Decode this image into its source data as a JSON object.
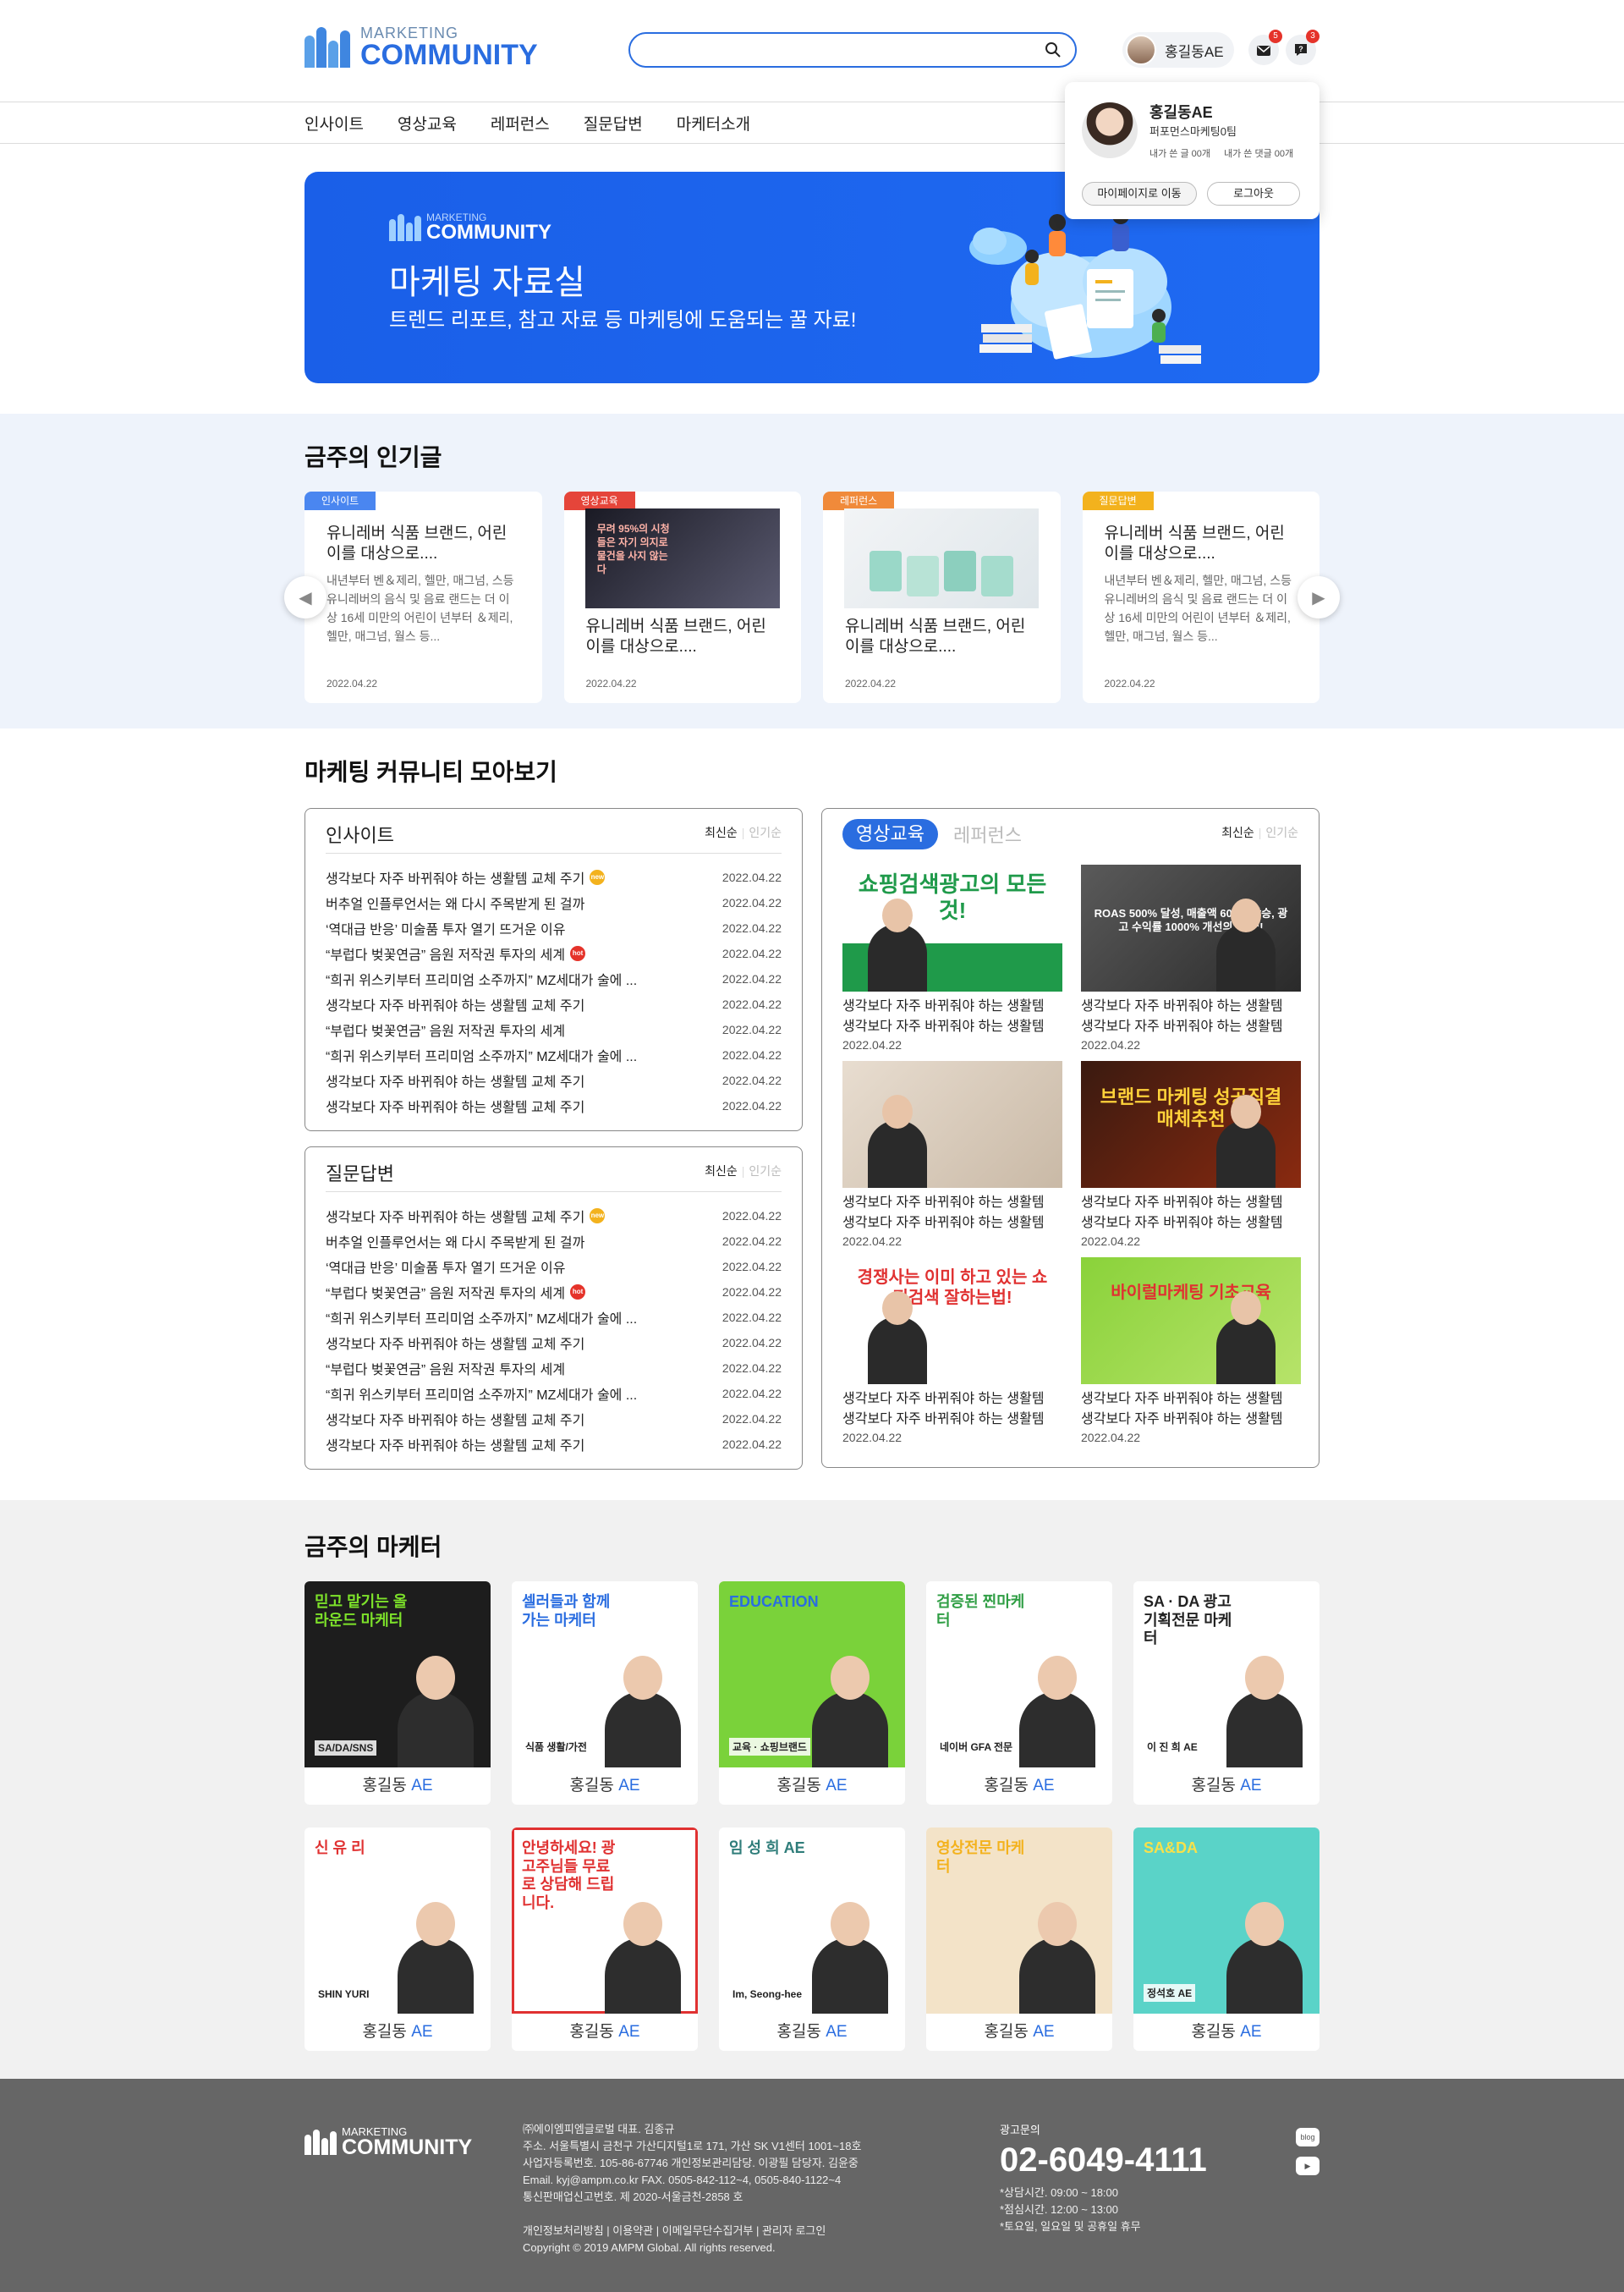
{
  "header": {
    "logo_small": "MARKETING",
    "logo_big": "COMMUNITY",
    "search_placeholder": "",
    "user_name": "홍길동AE",
    "mail_badge": "5",
    "help_badge": "3"
  },
  "nav": [
    "인사이트",
    "영상교육",
    "레퍼런스",
    "질문답변",
    "마케터소개"
  ],
  "profile_popup": {
    "name": "홍길동AE",
    "team": "퍼포먼스마케팅0팀",
    "posts": "내가 쓴 글 00개",
    "comments": "내가 쓴 댓글 00개",
    "mypage_button": "마이페이지로 이동",
    "logout_button": "로그아웃"
  },
  "banner": {
    "logo_small": "MARKETING",
    "logo_big": "COMMUNITY",
    "title": "마케팅 자료실",
    "subtitle": "트렌드 리포트, 참고 자료 등 마케팅에 도움되는 꿀 자료!"
  },
  "popular": {
    "title": "금주의 인기글",
    "cards": [
      {
        "tag": "인사이트",
        "tag_color": "#4a86f0",
        "title": "유니레버 식품 브랜드, 어린이를 대상으로....",
        "body": "내년부터 벤＆제리, 헬만, 매그넘, 스등 유니레버의 음식 및 음료 랜드는 더 이상 16세 미만의 어린이 년부터 ＆제리, 헬만, 매그넘, 월스 등...",
        "date": "2022.04.22"
      },
      {
        "tag": "영상교육",
        "tag_color": "#e5453a",
        "title": "유니레버 식품 브랜드, 어린이를 대상으로....",
        "thumb_text": "무려 95%의 시청들은 자기 의지로 물건을 사지 않는다",
        "date": "2022.04.22"
      },
      {
        "tag": "레퍼런스",
        "tag_color": "#f08a3a",
        "title": "유니레버 식품 브랜드, 어린이를 대상으로....",
        "date": "2022.04.22"
      },
      {
        "tag": "질문답변",
        "tag_color": "#f3b21d",
        "title": "유니레버 식품 브랜드, 어린이를 대상으로....",
        "body": "내년부터 벤＆제리, 헬만, 매그넘, 스등 유니레버의 음식 및 음료 랜드는 더 이상 16세 미만의 어린이 년부터 ＆제리, 헬만, 매그넘, 월스 등...",
        "date": "2022.04.22"
      }
    ]
  },
  "collection": {
    "title": "마케팅 커뮤니티 모아보기",
    "sort_latest": "최신순",
    "sort_popular": "인기순",
    "insight": {
      "title": "인사이트",
      "items": [
        {
          "text": "생각보다 자주 바뀌줘야 하는 생활템 교체 주기",
          "badge": "new",
          "date": "2022.04.22"
        },
        {
          "text": "버추얼 인플루언서는 왜 다시 주목받게 된 걸까",
          "badge": "",
          "date": "2022.04.22"
        },
        {
          "text": "‘역대급 반응’ 미술품 투자 열기 뜨거운 이유",
          "badge": "",
          "date": "2022.04.22"
        },
        {
          "text": "“부럽다 벚꽃연금” 음원 저작권 투자의 세계",
          "badge": "hot",
          "date": "2022.04.22"
        },
        {
          "text": "“희귀 위스키부터 프리미엄 소주까지” MZ세대가 술에 ...",
          "badge": "",
          "date": "2022.04.22"
        },
        {
          "text": "생각보다 자주 바뀌줘야 하는 생활템 교체 주기",
          "badge": "",
          "date": "2022.04.22"
        },
        {
          "text": "“부럽다 벚꽃연금” 음원 저작권 투자의 세계",
          "badge": "",
          "date": "2022.04.22"
        },
        {
          "text": "“희귀 위스키부터 프리미엄 소주까지” MZ세대가 술에 ...",
          "badge": "",
          "date": "2022.04.22"
        },
        {
          "text": "생각보다 자주 바뀌줘야 하는 생활템 교체 주기",
          "badge": "",
          "date": "2022.04.22"
        },
        {
          "text": "생각보다 자주 바뀌줘야 하는 생활템 교체 주기",
          "badge": "",
          "date": "2022.04.22"
        }
      ]
    },
    "qna": {
      "title": "질문답변",
      "items": [
        {
          "text": "생각보다 자주 바뀌줘야 하는 생활템 교체 주기",
          "badge": "new",
          "date": "2022.04.22"
        },
        {
          "text": "버추얼 인플루언서는 왜 다시 주목받게 된 걸까",
          "badge": "",
          "date": "2022.04.22"
        },
        {
          "text": "‘역대급 반응’ 미술품 투자 열기 뜨거운 이유",
          "badge": "",
          "date": "2022.04.22"
        },
        {
          "text": "“부럽다 벚꽃연금” 음원 저작권 투자의 세계",
          "badge": "hot",
          "date": "2022.04.22"
        },
        {
          "text": "“희귀 위스키부터 프리미엄 소주까지” MZ세대가 술에 ...",
          "badge": "",
          "date": "2022.04.22"
        },
        {
          "text": "생각보다 자주 바뀌줘야 하는 생활템 교체 주기",
          "badge": "",
          "date": "2022.04.22"
        },
        {
          "text": "“부럽다 벚꽃연금” 음원 저작권 투자의 세계",
          "badge": "",
          "date": "2022.04.22"
        },
        {
          "text": "“희귀 위스키부터 프리미엄 소주까지” MZ세대가 술에 ...",
          "badge": "",
          "date": "2022.04.22"
        },
        {
          "text": "생각보다 자주 바뀌줘야 하는 생활템 교체 주기",
          "badge": "",
          "date": "2022.04.22"
        },
        {
          "text": "생각보다 자주 바뀌줘야 하는 생활템 교체 주기",
          "badge": "",
          "date": "2022.04.22"
        }
      ]
    },
    "video": {
      "tab_on": "영상교육",
      "tab_off": "레퍼런스",
      "items": [
        {
          "thumb": "쇼핑검색광고의 모든 것!",
          "line1": "생각보다 자주 바뀌줘야 하는 생활템",
          "line2": "생각보다 자주 바뀌줘야 하는 생활템",
          "date": "2022.04.22"
        },
        {
          "thumb": "ROAS 500% 달성, 매출액 600% 상승, 광고 수익률 1000% 개선의 비법!!",
          "line1": "생각보다 자주 바뀌줘야 하는 생활템",
          "line2": "생각보다 자주 바뀌줘야 하는 생활템",
          "date": "2022.04.22"
        },
        {
          "thumb": "",
          "line1": "생각보다 자주 바뀌줘야 하는 생활템",
          "line2": "생각보다 자주 바뀌줘야 하는 생활템",
          "date": "2022.04.22"
        },
        {
          "thumb": "브랜드 마케팅 성공직결 매체추천",
          "line1": "생각보다 자주 바뀌줘야 하는 생활템",
          "line2": "생각보다 자주 바뀌줘야 하는 생활템",
          "date": "2022.04.22"
        },
        {
          "thumb": "경쟁사는 이미 하고 있는 쇼핑검색 잘하는법!",
          "line1": "생각보다 자주 바뀌줘야 하는 생활템",
          "line2": "생각보다 자주 바뀌줘야 하는 생활템",
          "date": "2022.04.22"
        },
        {
          "thumb": "바이럴마케팅 기초교육",
          "line1": "생각보다 자주 바뀌줘야 하는 생활템",
          "line2": "생각보다 자주 바뀌줘야 하는 생활템",
          "date": "2022.04.22"
        }
      ]
    }
  },
  "marketers": {
    "title": "금주의 마케터",
    "name": "홍길동",
    "suffix": "AE",
    "cards": [
      {
        "bg": "#1d1d1d",
        "accent": "#7de22a",
        "text": "믿고 맡기는 올라운드 마케터",
        "sub": "SA/DA/SNS"
      },
      {
        "bg": "#ffffff",
        "accent": "#2a6de0",
        "text": "셀러들과 함께 가는 마케터",
        "sub": "식품 생활/가전"
      },
      {
        "bg": "#7ad23a",
        "accent": "#2a6de0",
        "text": "EDUCATION",
        "sub": "교육 · 쇼핑브랜드"
      },
      {
        "bg": "#ffffff",
        "accent": "#2f9e44",
        "text": "검증된 찐마케터",
        "sub": "네이버 GFA 전문"
      },
      {
        "bg": "#ffffff",
        "accent": "#222222",
        "text": "SA · DA 광고기획전문 마케터",
        "sub": "이 진 희 AE"
      },
      {
        "bg": "#ffffff",
        "accent": "#e03131",
        "text": "신 유 리",
        "sub": "SHIN YURI"
      },
      {
        "bg": "#ffffff",
        "accent": "#e03131",
        "text": "안녕하세요! 광고주님들 무료로 상담해 드립니다.",
        "sub": ""
      },
      {
        "bg": "#ffffff",
        "accent": "#2f7d7a",
        "text": "임 성 희 AE",
        "sub": "Im, Seong-hee"
      },
      {
        "bg": "#f3e3c8",
        "accent": "#f3b21d",
        "text": "영상전문 마케터",
        "sub": ""
      },
      {
        "bg": "#5ad3c8",
        "accent": "#f7e14b",
        "text": "SA&DA",
        "sub": "정석호 AE"
      }
    ]
  },
  "footer": {
    "logo_small": "MARKETING",
    "logo_big": "COMMUNITY",
    "info": [
      "㈜에이엠피엠글로벌  대표. 김종규",
      "주소. 서울특별시 금천구 가산디지털1로 171, 가산 SK V1센터 1001~18호",
      "사업자등록번호. 105-86-67746  개인정보관리담당. 이광필  담당자. 김윤중",
      "Email. kyj@ampm.co.kr  FAX. 0505-842-112~4, 0505-840-1122~4",
      "통신판매업신고번호. 제 2020-서울금천-2858 호"
    ],
    "links": "개인정보처리방침 | 이용약관 | 이메일무단수집거부 | 관리자 로그인",
    "copyright": "Copyright © 2019 AMPM Global. All rights reserved.",
    "contact_label": "광고문의",
    "tel": "02-6049-4111",
    "hours": [
      "*상담시간. 09:00 ~ 18:00",
      "*점심시간. 12:00 ~ 13:00",
      "*토요일, 일요일 및 공휴일 휴무"
    ],
    "blog": "blog",
    "youtube": "▶"
  }
}
